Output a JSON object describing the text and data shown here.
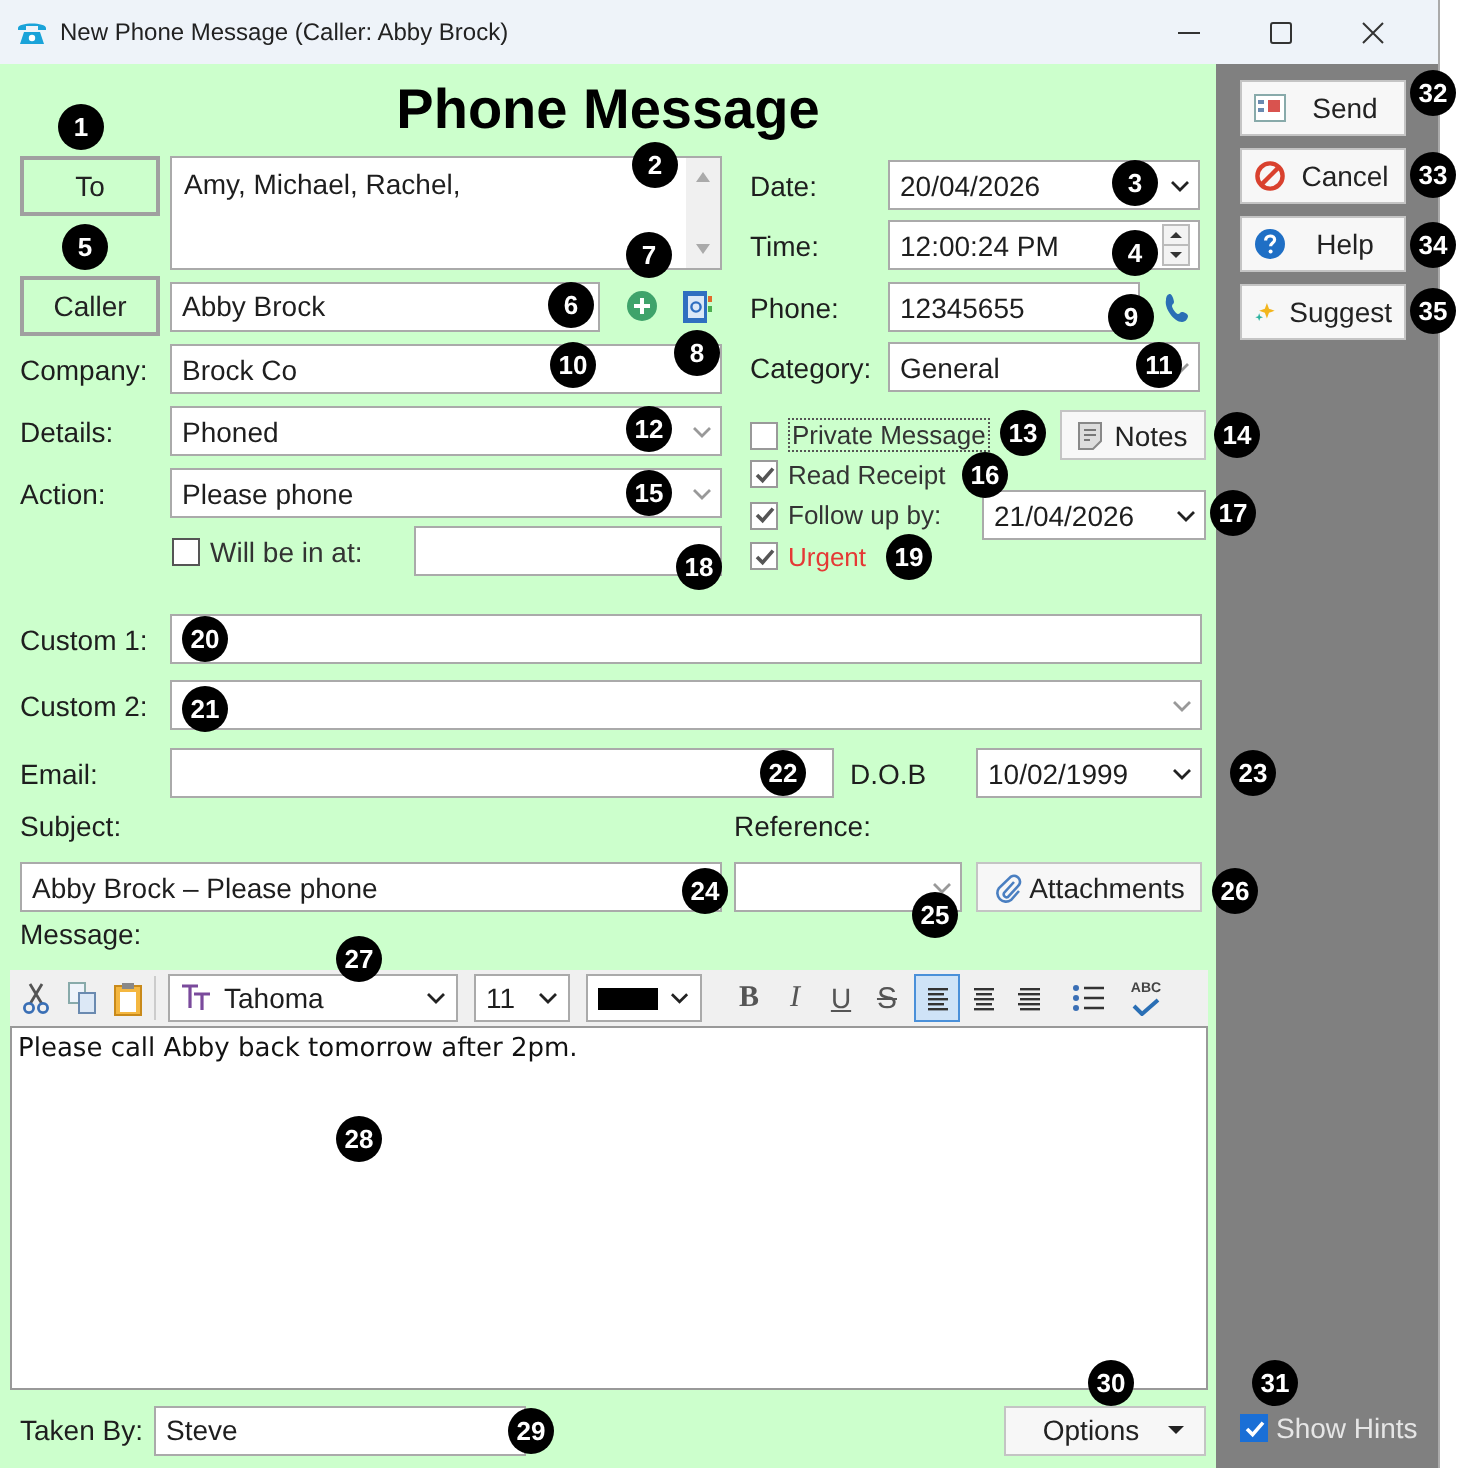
{
  "window": {
    "title": "New Phone Message (Caller: Abby Brock)"
  },
  "heading": "Phone Message",
  "to": {
    "button": "To",
    "value": "Amy, Michael, Rachel,"
  },
  "caller": {
    "button": "Caller",
    "value": "Abby Brock"
  },
  "left_fields": [
    {
      "label": "Company:",
      "kind": "text",
      "value": "Brock Co"
    },
    {
      "label": "Details:",
      "kind": "dropdown",
      "value": "Phoned"
    },
    {
      "label": "Action:",
      "kind": "dropdown",
      "value": "Please phone"
    }
  ],
  "will_be_in": {
    "label": "Will be in at:",
    "checked": false
  },
  "right_fields": [
    {
      "label": "Date:",
      "kind": "date",
      "value": "20/04/2026"
    },
    {
      "label": "Time:",
      "kind": "time",
      "value": "12:00:24 PM"
    },
    {
      "label": "Phone:",
      "kind": "phone",
      "value": "12345655"
    },
    {
      "label": "Category:",
      "kind": "dropdown",
      "value": "General"
    }
  ],
  "flags": [
    {
      "label": "Private Message",
      "kind": "focus",
      "checked": false
    },
    {
      "label": "Read Receipt",
      "kind": "plain",
      "checked": true
    },
    {
      "label": "Follow up by:",
      "kind": "date",
      "checked": true,
      "value": "21/04/2026"
    },
    {
      "label": "Urgent",
      "kind": "alert",
      "checked": true
    }
  ],
  "notes_button": "Notes",
  "custom_fields": [
    {
      "label": "Custom 1:",
      "kind": "text"
    },
    {
      "label": "Custom 2:",
      "kind": "dropdown"
    }
  ],
  "email": {
    "label": "Email:"
  },
  "dob": {
    "label": "D.O.B",
    "value": "10/02/1999"
  },
  "subject": {
    "label": "Subject:",
    "value": "Abby Brock – Please phone"
  },
  "reference": {
    "label": "Reference:"
  },
  "attachments_button": "Attachments",
  "message": {
    "label": "Message:",
    "font": "Tahoma",
    "size": "11",
    "text": "Please call Abby back tomorrow after 2pm."
  },
  "format_buttons": [
    "B",
    "I",
    "U",
    "S"
  ],
  "alignment": [
    {
      "selected": true
    },
    {
      "selected": false
    },
    {
      "selected": false
    }
  ],
  "spell_check": "ABC",
  "taken_by": {
    "label": "Taken By:",
    "value": "Steve"
  },
  "options_button": "Options",
  "side_buttons": [
    {
      "label": "Send",
      "kind": "send"
    },
    {
      "label": "Cancel",
      "kind": "cancel"
    },
    {
      "label": "Help",
      "kind": "help"
    },
    {
      "label": "Suggest",
      "kind": "suggest"
    }
  ],
  "show_hints": {
    "label": "Show Hints",
    "checked": true
  },
  "callouts": [
    "1",
    "2",
    "3",
    "5",
    "4",
    "6",
    "7",
    "8",
    "9",
    "10",
    "11",
    "12",
    "13",
    "14",
    "15",
    "16",
    "17",
    "18",
    "19",
    "20",
    "21",
    "22",
    "23",
    "24",
    "25",
    "26",
    "27",
    "28",
    "29",
    "30",
    "31",
    "32",
    "33",
    "34",
    "35"
  ]
}
